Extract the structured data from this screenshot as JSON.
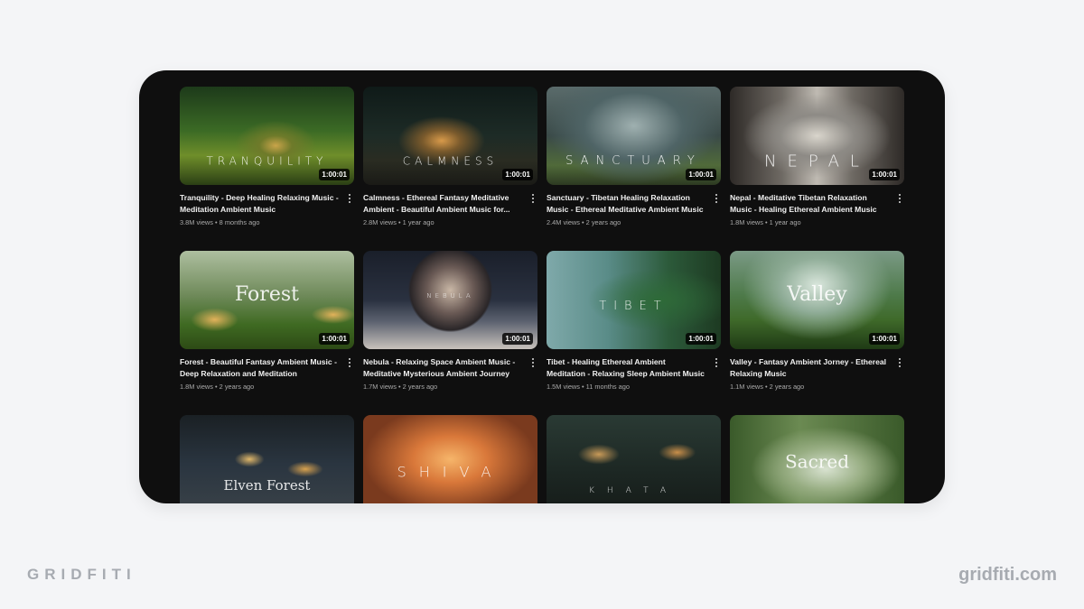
{
  "brand": {
    "left": "GRIDFITI",
    "right": "gridfiti.com"
  },
  "videos": [
    {
      "thumb_text": "TRANQUILITY",
      "duration": "1:00:01",
      "title": "Tranquility - Deep Healing Relaxing Music - Meditation Ambient Music",
      "stats": "3.8M views • 8 months ago"
    },
    {
      "thumb_text": "CALMNESS",
      "duration": "1:00:01",
      "title": "Calmness - Ethereal Fantasy Meditative Ambient - Beautiful Ambient Music for...",
      "stats": "2.8M views • 1 year ago"
    },
    {
      "thumb_text": "SANCTUARY",
      "duration": "1:00:01",
      "title": "Sanctuary - Tibetan Healing Relaxation Music - Ethereal Meditative Ambient Music",
      "stats": "2.4M views • 2 years ago"
    },
    {
      "thumb_text": "NEPAL",
      "duration": "1:00:01",
      "title": "Nepal - Meditative Tibetan Relaxation Music - Healing Ethereal Ambient Music",
      "stats": "1.8M views • 1 year ago"
    },
    {
      "thumb_text": "Forest",
      "duration": "1:00:01",
      "title": "Forest - Beautiful Fantasy Ambient Music - Deep Relaxation and Meditation",
      "stats": "1.8M views • 2 years ago"
    },
    {
      "thumb_text": "NEBULA",
      "duration": "1:00:01",
      "title": "Nebula - Relaxing Space Ambient Music - Meditative Mysterious Ambient Journey",
      "stats": "1.7M views • 2 years ago"
    },
    {
      "thumb_text": "TIBET",
      "duration": "1:00:01",
      "title": "Tibet - Healing Ethereal Ambient Meditation - Relaxing Sleep Ambient Music",
      "stats": "1.5M views • 11 months ago"
    },
    {
      "thumb_text": "Valley",
      "duration": "1:00:01",
      "title": "Valley - Fantasy Ambient Jorney - Ethereal Relaxing Music",
      "stats": "1.1M views • 2 years ago"
    },
    {
      "thumb_text": "Elven Forest"
    },
    {
      "thumb_text": "SHIVA"
    },
    {
      "thumb_text": "KHATA"
    },
    {
      "thumb_text": "Sacred"
    }
  ]
}
